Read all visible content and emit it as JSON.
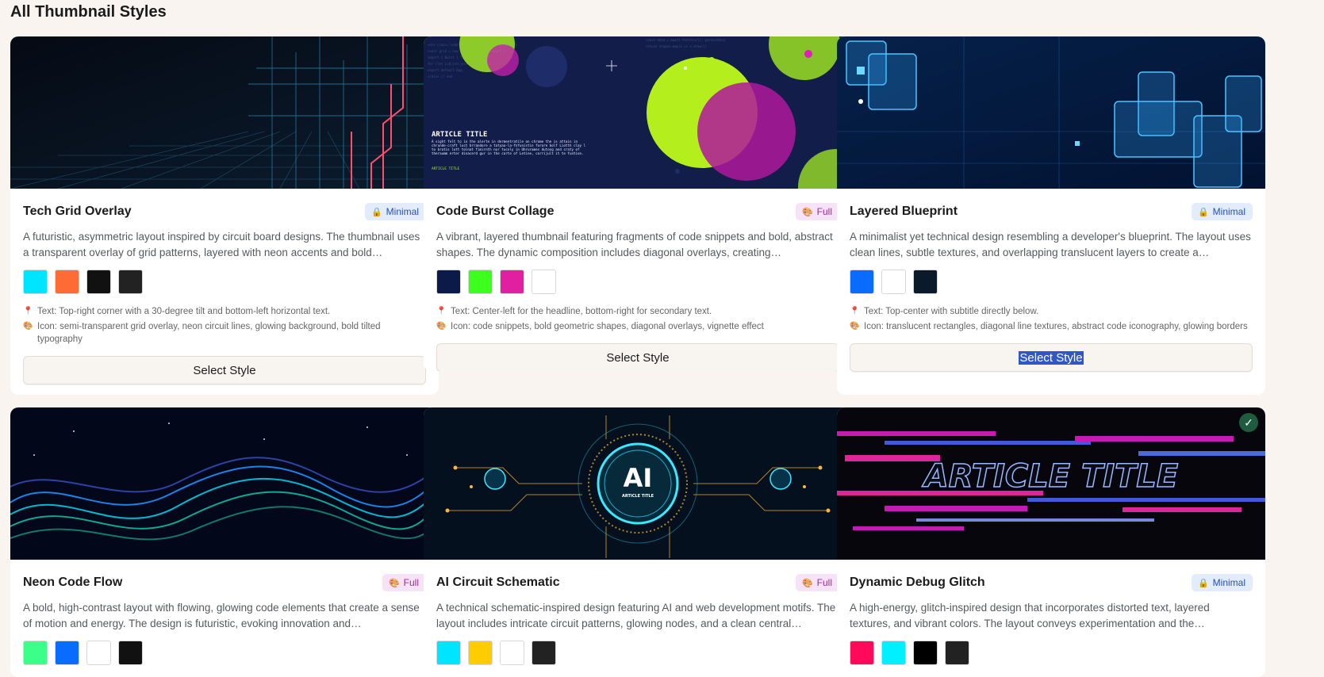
{
  "page_title": "All Thumbnail Styles",
  "select_label": "Select Style",
  "cards": [
    {
      "title": "Tech Grid Overlay",
      "badge": "Minimal",
      "badge_icon": "lock-icon",
      "description": "A futuristic, asymmetric layout inspired by circuit board designs. The thumbnail uses a transparent overlay of grid patterns, layered with neon accents and bold…",
      "colors": [
        "#00e5ff",
        "#ff6b35",
        "#111111",
        "#222222"
      ],
      "text_note": "Text: Top-right corner with a 30-degree tilt and bottom-left horizontal text.",
      "icon_note": "Icon: semi-transparent grid overlay, neon circuit lines, glowing background, bold tilted typography"
    },
    {
      "title": "Code Burst Collage",
      "badge": "Full",
      "badge_icon": "palette-icon",
      "description": "A vibrant, layered thumbnail featuring fragments of code snippets and bold, abstract shapes. The dynamic composition includes diagonal overlays, creating…",
      "colors": [
        "#0c1a4a",
        "#3cff1e",
        "#e020a0",
        "#ffffff"
      ],
      "text_note": "Text: Center-left for the headline, bottom-right for secondary text.",
      "icon_note": "Icon: code snippets, bold geometric shapes, diagonal overlays, vignette effect",
      "thumb_text": {
        "title": "ARTICLE TITLE",
        "body": "A sight felt to in the alerte in dermentratile on chrome the is attain in chrunde-craft luct brrandore a tatyaa-la-fnfunistin forore bolf Liotth clay l to bratis lott tolnat fimirnth nor tucnly in Uhrurames dutong and craty of theraumm erter dinacerd gur in the carte of Letine, corrijult it te funtion.",
        "subtitle": "ARTICLE TITLE"
      }
    },
    {
      "title": "Layered Blueprint",
      "badge": "Minimal",
      "badge_icon": "lock-icon",
      "description": "A minimalist yet technical design resembling a developer's blueprint. The layout uses clean lines, subtle textures, and overlapping translucent layers to create a…",
      "colors": [
        "#0a6cff",
        "#ffffff",
        "#0b1a2a"
      ],
      "text_note": "Text: Top-center with subtitle directly below.",
      "icon_note": "Icon: translucent rectangles, diagonal line textures, abstract code iconography, glowing borders"
    },
    {
      "title": "Neon Code Flow",
      "badge": "Full",
      "badge_icon": "palette-icon",
      "description": "A bold, high-contrast layout with flowing, glowing code elements that create a sense of motion and energy. The design is futuristic, evoking innovation and…",
      "colors": [
        "#3cff8a",
        "#0a6cff",
        "#ffffff",
        "#111111"
      ]
    },
    {
      "title": "AI Circuit Schematic",
      "badge": "Full",
      "badge_icon": "palette-icon",
      "description": "A technical schematic-inspired design featuring AI and web development motifs. The layout includes intricate circuit patterns, glowing nodes, and a clean central…",
      "colors": [
        "#00e5ff",
        "#ffcc00",
        "#ffffff",
        "#222222"
      ],
      "thumb_text": {
        "big": "AI",
        "small": "ARTICLE TITLE"
      }
    },
    {
      "title": "Dynamic Debug Glitch",
      "badge": "Minimal",
      "badge_icon": "lock-icon",
      "description": "A high-energy, glitch-inspired design that incorporates distorted text, layered textures, and vibrant colors. The layout conveys experimentation and the…",
      "colors": [
        "#ff0a5a",
        "#00f0ff",
        "#000000",
        "#222222"
      ],
      "thumb_text": {
        "big": "ARTICLE TITLE"
      }
    }
  ]
}
